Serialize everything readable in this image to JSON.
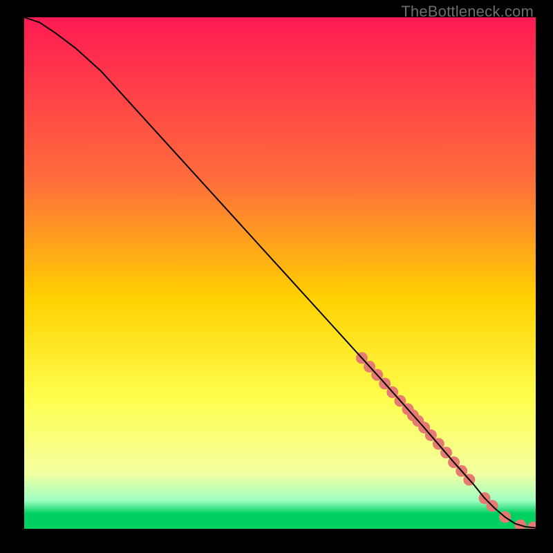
{
  "watermark": "TheBottleneck.com",
  "colors": {
    "top": "#ff1a53",
    "mid1": "#ff6e3b",
    "mid2": "#ffd100",
    "mid3": "#ffff50",
    "mid4": "#f4ffa0",
    "band": "#9effc3",
    "bottom": "#00d060",
    "dot": "#e67a72",
    "line": "#000000"
  },
  "gradient_stops": [
    {
      "offset": 0,
      "key": "top"
    },
    {
      "offset": 32,
      "key": "mid1"
    },
    {
      "offset": 55,
      "key": "mid2"
    },
    {
      "offset": 75,
      "key": "mid3"
    },
    {
      "offset": 89,
      "key": "mid4"
    },
    {
      "offset": 94.5,
      "key": "band"
    },
    {
      "offset": 97,
      "key": "bottom"
    },
    {
      "offset": 100,
      "key": "bottom"
    }
  ],
  "chart_data": {
    "type": "line",
    "title": "",
    "xlabel": "",
    "ylabel": "",
    "xlim": [
      0,
      100
    ],
    "ylim": [
      0,
      100
    ],
    "series": [
      {
        "name": "curve",
        "x": [
          0,
          3,
          6,
          10,
          15,
          20,
          30,
          40,
          50,
          60,
          70,
          78,
          84,
          88,
          90,
          92,
          94,
          96,
          98,
          100
        ],
        "y": [
          100,
          99,
          97,
          94,
          89.5,
          84,
          73,
          62,
          51,
          40,
          29,
          20,
          13,
          8.5,
          6,
          4,
          2.3,
          1,
          0.4,
          0.2
        ]
      }
    ],
    "dots": {
      "name": "sample-points",
      "x": [
        66,
        67.5,
        69,
        70.5,
        72,
        73.5,
        75,
        76,
        77,
        78.2,
        79.5,
        81,
        82.5,
        84,
        85.5,
        87,
        90,
        91.5,
        94,
        97,
        99.5
      ],
      "y": [
        33.4,
        31.7,
        30.1,
        28.4,
        26.7,
        25.0,
        23.4,
        22.2,
        21.1,
        19.8,
        18.3,
        16.6,
        14.9,
        13.0,
        11.3,
        9.6,
        6.0,
        4.5,
        2.3,
        0.7,
        0.25
      ]
    }
  }
}
